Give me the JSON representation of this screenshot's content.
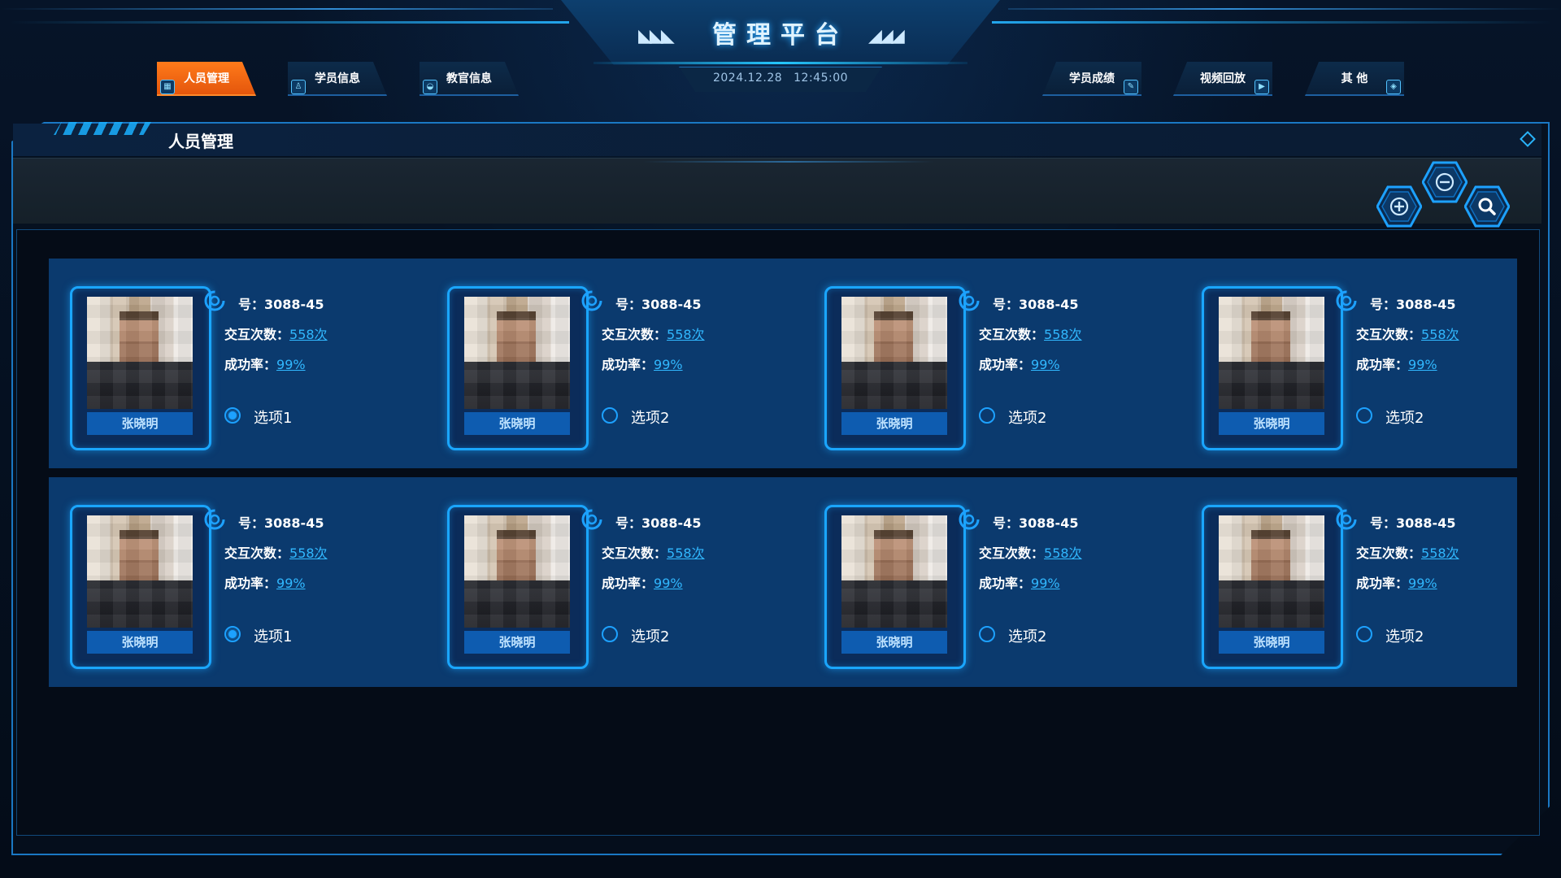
{
  "header": {
    "title": "管理平台",
    "date": "2024.12.28",
    "time": "12:45:00",
    "accent": "#1aa6ff",
    "active_tab_color": "#f06414"
  },
  "nav": {
    "left": [
      {
        "label": "人员管理",
        "icon": "building-icon",
        "active": true
      },
      {
        "label": "学员信息",
        "icon": "user-icon",
        "active": false
      },
      {
        "label": "教官信息",
        "icon": "cap-icon",
        "active": false
      }
    ],
    "right": [
      {
        "label": "学员成绩",
        "icon": "edit-doc-icon",
        "active": false
      },
      {
        "label": "视频回放",
        "icon": "play-icon",
        "active": false
      },
      {
        "label": "其 他",
        "icon": "cube-icon",
        "active": false
      }
    ]
  },
  "panel": {
    "title": "人员管理"
  },
  "toolbar": {
    "add_icon": "plus-circle-icon",
    "remove_icon": "minus-circle-icon",
    "search_icon": "search-icon"
  },
  "cards": [
    {
      "name": "张晓明",
      "id_prefix": "号：",
      "id": "3088-45",
      "count_label": "交互次数：",
      "count": "558次",
      "rate_label": "成功率：",
      "rate": "99%",
      "option": "选项1",
      "selected": true
    },
    {
      "name": "张晓明",
      "id_prefix": "号：",
      "id": "3088-45",
      "count_label": "交互次数：",
      "count": "558次",
      "rate_label": "成功率：",
      "rate": "99%",
      "option": "选项2",
      "selected": false
    },
    {
      "name": "张晓明",
      "id_prefix": "号：",
      "id": "3088-45",
      "count_label": "交互次数：",
      "count": "558次",
      "rate_label": "成功率：",
      "rate": "99%",
      "option": "选项2",
      "selected": false
    },
    {
      "name": "张晓明",
      "id_prefix": "号：",
      "id": "3088-45",
      "count_label": "交互次数：",
      "count": "558次",
      "rate_label": "成功率：",
      "rate": "99%",
      "option": "选项2",
      "selected": false
    },
    {
      "name": "张晓明",
      "id_prefix": "号：",
      "id": "3088-45",
      "count_label": "交互次数：",
      "count": "558次",
      "rate_label": "成功率：",
      "rate": "99%",
      "option": "选项1",
      "selected": true
    },
    {
      "name": "张晓明",
      "id_prefix": "号：",
      "id": "3088-45",
      "count_label": "交互次数：",
      "count": "558次",
      "rate_label": "成功率：",
      "rate": "99%",
      "option": "选项2",
      "selected": false
    },
    {
      "name": "张晓明",
      "id_prefix": "号：",
      "id": "3088-45",
      "count_label": "交互次数：",
      "count": "558次",
      "rate_label": "成功率：",
      "rate": "99%",
      "option": "选项2",
      "selected": false
    },
    {
      "name": "张晓明",
      "id_prefix": "号：",
      "id": "3088-45",
      "count_label": "交互次数：",
      "count": "558次",
      "rate_label": "成功率：",
      "rate": "99%",
      "option": "选项2",
      "selected": false
    }
  ]
}
